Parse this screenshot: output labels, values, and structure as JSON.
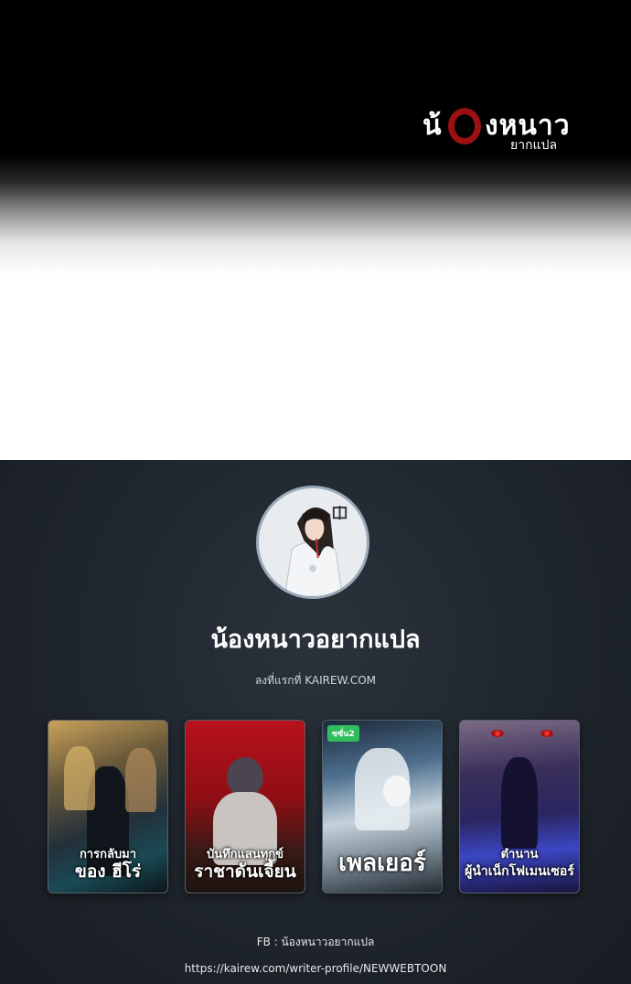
{
  "logo": {
    "main_prefix": "น้",
    "main_suffix": "งหนาว",
    "sub": "ยากแปล"
  },
  "profile": {
    "name": "น้องหนาวอยากแปล",
    "subtitle": "ลงที่แรกที่ KAIREW.COM"
  },
  "covers": [
    {
      "title_line1": "การกลับมา",
      "title_line2": "ของ ฮีโร่",
      "badge": ""
    },
    {
      "title_line1": "บันทึกแสนทุกข์",
      "title_line2": "ราชาดันเจี้ยน",
      "badge": ""
    },
    {
      "title_line1": "",
      "title_line2": "เพลเยอร์",
      "badge": "ซซั่น2"
    },
    {
      "title_line1": "ตำนาน",
      "title_line2": "ผู้นำเน็กโฟเมนเซอร์",
      "badge": ""
    }
  ],
  "footer": {
    "fb": "FB : น้องหนาวอยากแปล",
    "url": "https://kairew.com/writer-profile/NEWWEBTOON"
  }
}
